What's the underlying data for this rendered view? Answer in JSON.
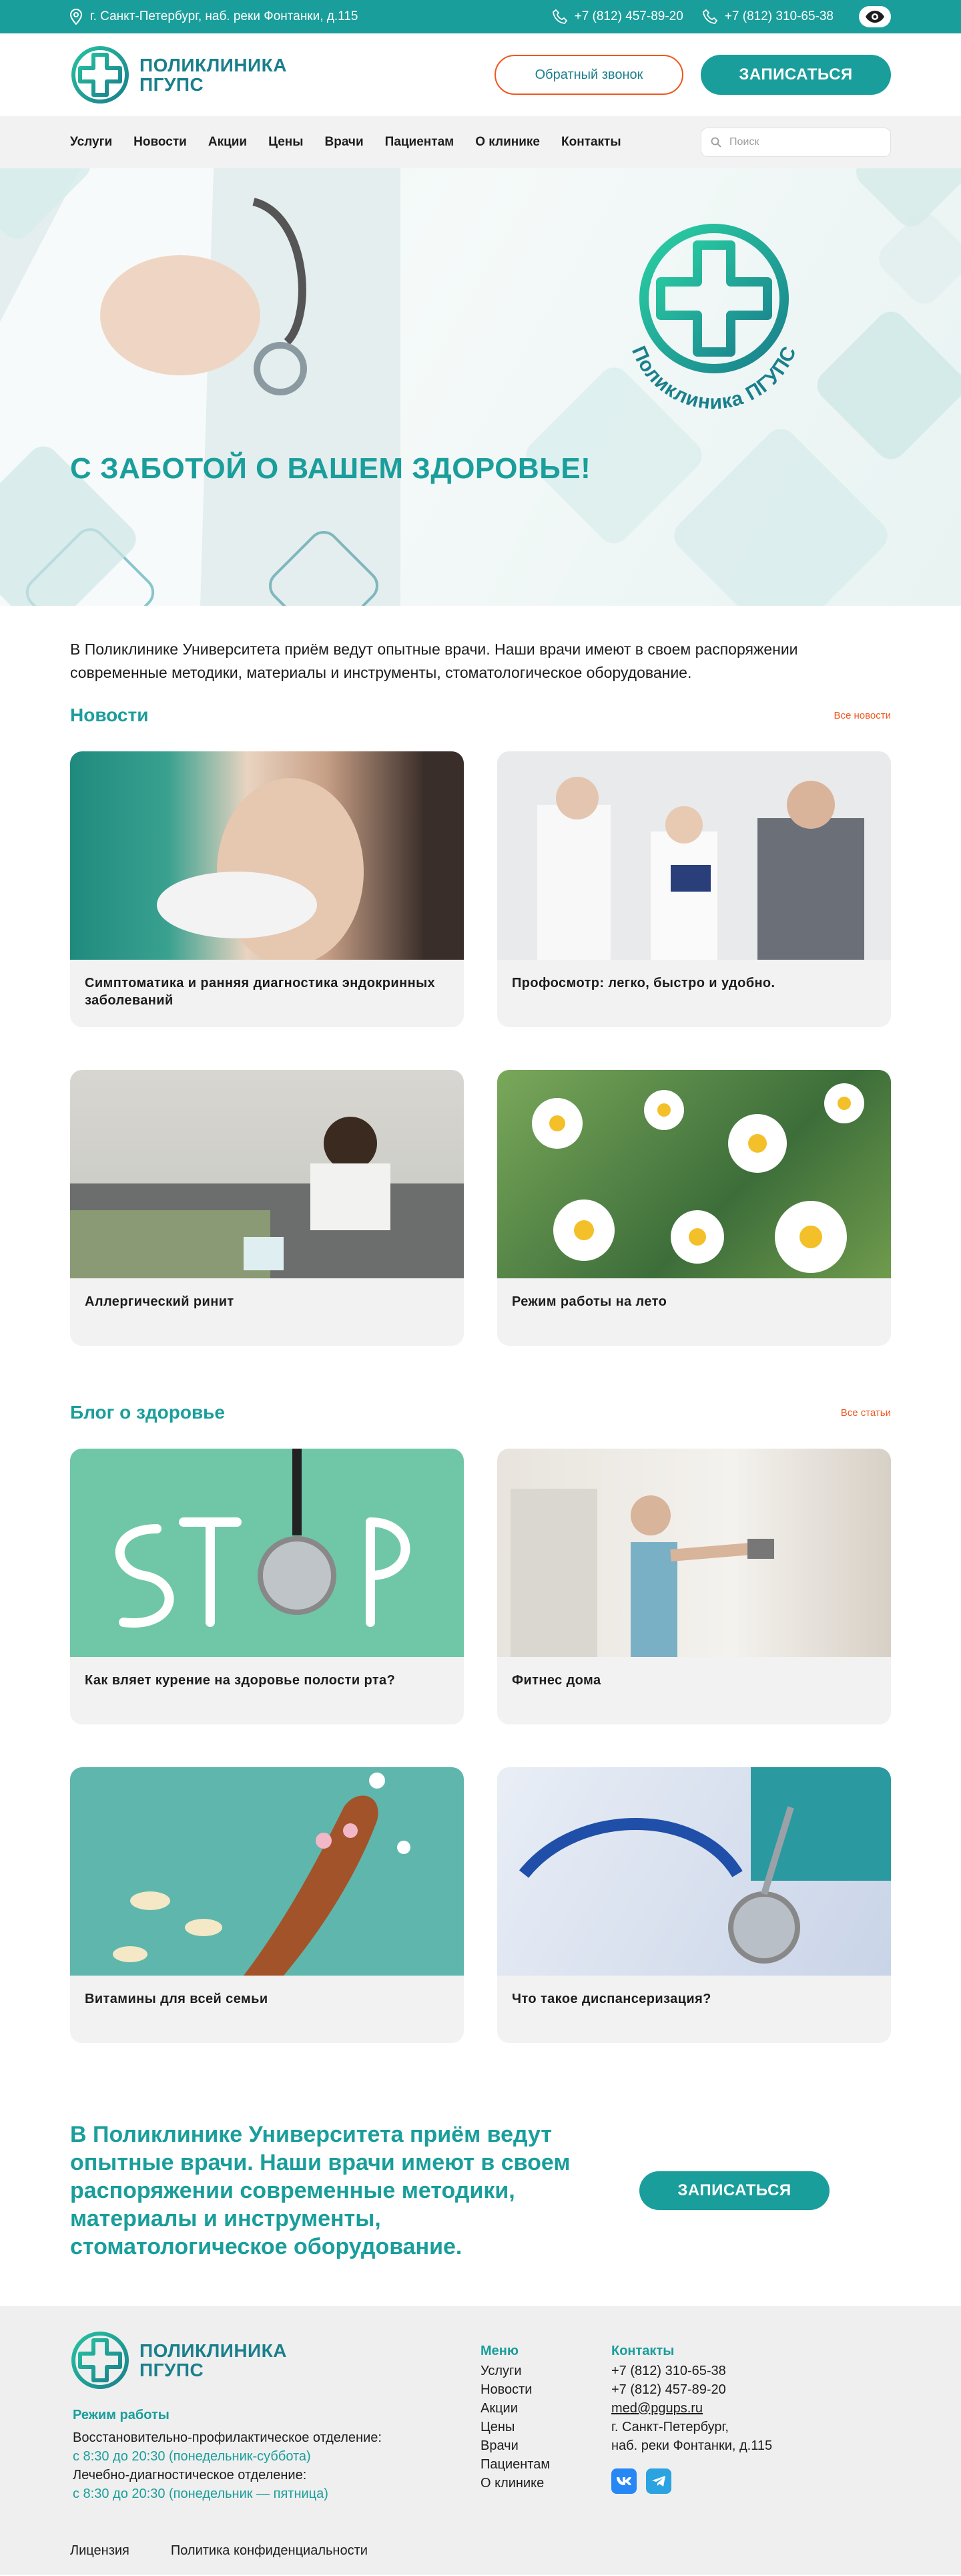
{
  "topbar": {
    "address": "г. Санкт-Петербург, наб. реки Фонтанки, д.115",
    "phone1": "+7 (812) 457-89-20",
    "phone2": "+7 (812) 310-65-38"
  },
  "header": {
    "logo_line1": "ПОЛИКЛИНИКА",
    "logo_line2": "ПГУПС",
    "callback_label": "Обратный звонок",
    "signup_label": "ЗАПИСАТЬСЯ"
  },
  "nav": {
    "items": [
      "Услуги",
      "Новости",
      "Акции",
      "Цены",
      "Врачи",
      "Пациентам",
      "О клинике",
      "Контакты"
    ],
    "search_placeholder": "Поиск"
  },
  "hero": {
    "title": "С ЗАБОТОЙ О ВАШЕМ ЗДОРОВЬЕ!",
    "ring_text": "Поликлиника ПГУПС"
  },
  "intro": "В Поликлинике Университета приём ведут опытные врачи. Наши врачи имеют в своем распоряжении современные методики, материалы и инструменты, стоматологическое оборудование.",
  "news": {
    "title": "Новости",
    "all_link": "Все новости",
    "items": [
      {
        "title": "Симптоматика и ранняя диагностика эндокринных заболеваний"
      },
      {
        "title": "Профосмотр: легко, быстро и удобно."
      },
      {
        "title": "Аллергический ринит"
      },
      {
        "title": "Режим работы на лето"
      }
    ]
  },
  "blog": {
    "title": "Блог о здоровье",
    "all_link": "Все статьи",
    "items": [
      {
        "title": "Как вляет курение на здоровье полости рта?"
      },
      {
        "title": "Фитнес дома"
      },
      {
        "title": "Витамины для всей семьи"
      },
      {
        "title": "Что такое диспансеризация?"
      }
    ]
  },
  "cta": {
    "text": "В Поликлинике Университета приём ведут опытные врачи. Наши врачи имеют в своем распоряжении современные методики, материалы и инструменты, стоматологическое оборудование.",
    "button": "ЗАПИСАТЬСЯ"
  },
  "footer": {
    "logo_line1": "ПОЛИКЛИНИКА",
    "logo_line2": "ПГУПС",
    "hours_title": "Режим работы",
    "dept1": "Восстановительно-профилактическое отделение:",
    "dept1_hours": "с 8:30 до 20:30 (понедельник-суббота)",
    "dept2": "Лечебно-диагностическое отделение:",
    "dept2_hours": "с 8:30 до 20:30 (понедельник — пятница)",
    "menu_title": "Меню",
    "menu": [
      "Услуги",
      "Новости",
      "Акции",
      "Цены",
      "Врачи",
      "Пациентам",
      "О клинике"
    ],
    "contacts_title": "Контакты",
    "phone1": "+7 (812) 310-65-38",
    "phone2": "+7 (812) 457-89-20",
    "email": "med@pgups.ru",
    "addr1": "г. Санкт-Петербург,",
    "addr2": "наб. реки Фонтанки, д.115",
    "license": "Лицензия",
    "privacy": "Политика конфиденциальности"
  },
  "colors": {
    "teal": "#1a9e9b",
    "orange": "#f0561e",
    "dark_teal": "#1a7f8c"
  }
}
